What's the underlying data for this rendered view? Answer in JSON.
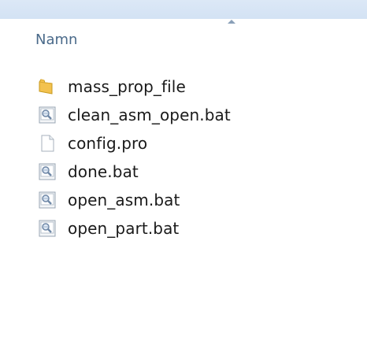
{
  "header": {
    "column_name": "Namn"
  },
  "files": [
    {
      "name": "mass_prop_file",
      "icon": "folder-icon"
    },
    {
      "name": "clean_asm_open.bat",
      "icon": "batch-file-icon"
    },
    {
      "name": "config.pro",
      "icon": "document-icon"
    },
    {
      "name": "done.bat",
      "icon": "batch-file-icon"
    },
    {
      "name": "open_asm.bat",
      "icon": "batch-file-icon"
    },
    {
      "name": "open_part.bat",
      "icon": "batch-file-icon"
    }
  ],
  "colors": {
    "header_strip": "#d3e2f4",
    "column_header_text": "#4a6a8a",
    "folder": "#f3c24f"
  }
}
